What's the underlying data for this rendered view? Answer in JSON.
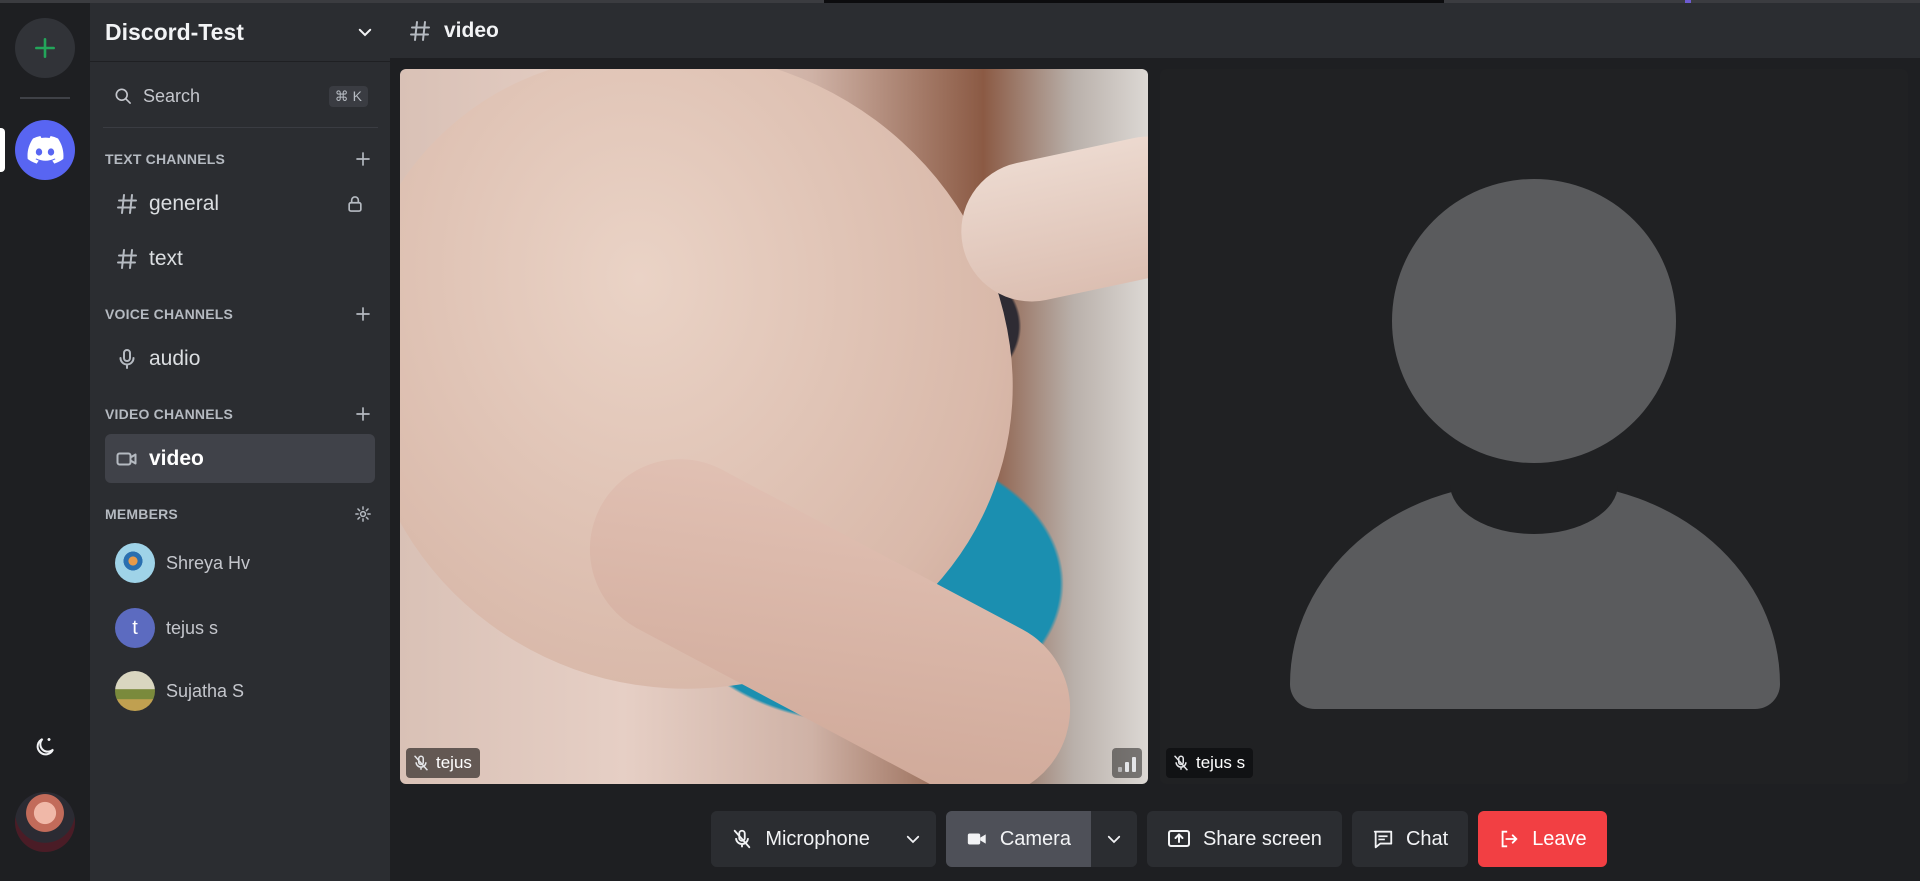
{
  "server": {
    "name": "Discord-Test"
  },
  "search": {
    "label": "Search",
    "shortcut": "⌘ K"
  },
  "sections": {
    "text": "TEXT CHANNELS",
    "voice": "VOICE CHANNELS",
    "video": "VIDEO CHANNELS",
    "members": "MEMBERS"
  },
  "channels": {
    "text": [
      {
        "name": "general",
        "locked": true
      },
      {
        "name": "text",
        "locked": false
      }
    ],
    "voice": [
      {
        "name": "audio"
      }
    ],
    "video": [
      {
        "name": "video",
        "active": true
      }
    ]
  },
  "members": [
    {
      "name": "Shreya Hv",
      "initial": ""
    },
    {
      "name": "tejus s",
      "initial": "t"
    },
    {
      "name": "Sujatha S",
      "initial": ""
    }
  ],
  "main": {
    "channel": "video"
  },
  "participants": [
    {
      "name": "tejus",
      "muted": true,
      "video": true
    },
    {
      "name": "tejus s",
      "muted": true,
      "video": false
    }
  ],
  "controls": {
    "microphone": "Microphone",
    "camera": "Camera",
    "share": "Share screen",
    "chat": "Chat",
    "leave": "Leave"
  },
  "colors": {
    "accent": "#5865f2",
    "leave": "#f23f43",
    "add": "#23a55a"
  }
}
